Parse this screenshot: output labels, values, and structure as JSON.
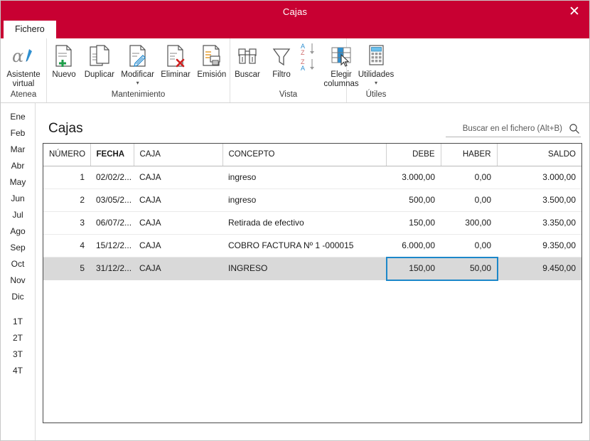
{
  "window": {
    "title": "Cajas",
    "close_label": "✕",
    "tab_label": "Fichero"
  },
  "ribbon": {
    "groups": [
      {
        "label": "Atenea",
        "buttons": [
          {
            "label": "Asistente\nvirtual",
            "icon": "alpha-assistant-icon",
            "caret": false
          }
        ]
      },
      {
        "label": "Mantenimiento",
        "buttons": [
          {
            "label": "Nuevo",
            "icon": "new-document-icon",
            "caret": false
          },
          {
            "label": "Duplicar",
            "icon": "duplicate-document-icon",
            "caret": false
          },
          {
            "label": "Modificar",
            "icon": "edit-document-icon",
            "caret": true
          },
          {
            "label": "Eliminar",
            "icon": "delete-document-icon",
            "caret": false
          },
          {
            "label": "Emisión",
            "icon": "print-report-icon",
            "caret": false
          }
        ]
      },
      {
        "label": "Vista",
        "buttons": [
          {
            "label": "Buscar",
            "icon": "binoculars-icon",
            "caret": false
          },
          {
            "label": "Filtro",
            "icon": "funnel-filter-icon",
            "caret": false
          },
          {
            "label": "",
            "icon": "sort-az-za-icon",
            "caret": false
          },
          {
            "label": "Elegir\ncolumnas",
            "icon": "choose-columns-icon",
            "caret": false
          }
        ]
      },
      {
        "label": "Útiles",
        "buttons": [
          {
            "label": "Utilidades",
            "icon": "calculator-icon",
            "caret": true
          }
        ]
      }
    ]
  },
  "sidebar": {
    "months": [
      "Ene",
      "Feb",
      "Mar",
      "Abr",
      "May",
      "Jun",
      "Jul",
      "Ago",
      "Sep",
      "Oct",
      "Nov",
      "Dic"
    ],
    "quarters": [
      "1T",
      "2T",
      "3T",
      "4T"
    ]
  },
  "main": {
    "page_title": "Cajas",
    "search": {
      "placeholder": "Buscar en el fichero (Alt+B)",
      "value": "",
      "icon": "search-icon"
    },
    "grid": {
      "columns": [
        {
          "key": "numero",
          "label": "NÚMERO",
          "align": "right",
          "sorted": false
        },
        {
          "key": "fecha",
          "label": "FECHA",
          "align": "left",
          "sorted": true
        },
        {
          "key": "caja",
          "label": "CAJA",
          "align": "left",
          "sorted": false
        },
        {
          "key": "concepto",
          "label": "CONCEPTO",
          "align": "left",
          "sorted": false
        },
        {
          "key": "debe",
          "label": "DEBE",
          "align": "right",
          "sorted": false
        },
        {
          "key": "haber",
          "label": "HABER",
          "align": "right",
          "sorted": false
        },
        {
          "key": "saldo",
          "label": "SALDO",
          "align": "right",
          "sorted": false
        }
      ],
      "rows": [
        {
          "numero": "1",
          "fecha": "02/02/2...",
          "caja": "CAJA",
          "concepto": "ingreso",
          "debe": "3.000,00",
          "haber": "0,00",
          "saldo": "3.000,00",
          "selected": false
        },
        {
          "numero": "2",
          "fecha": "03/05/2...",
          "caja": "CAJA",
          "concepto": "ingreso",
          "debe": "500,00",
          "haber": "0,00",
          "saldo": "3.500,00",
          "selected": false
        },
        {
          "numero": "3",
          "fecha": "06/07/2...",
          "caja": "CAJA",
          "concepto": "Retirada de efectivo",
          "debe": "150,00",
          "haber": "300,00",
          "saldo": "3.350,00",
          "selected": false
        },
        {
          "numero": "4",
          "fecha": "15/12/2...",
          "caja": "CAJA",
          "concepto": "COBRO FACTURA Nº 1 -000015",
          "debe": "6.000,00",
          "haber": "0,00",
          "saldo": "9.350,00",
          "selected": false
        },
        {
          "numero": "5",
          "fecha": "31/12/2...",
          "caja": "CAJA",
          "concepto": "INGRESO",
          "debe": "150,00",
          "haber": "50,00",
          "saldo": "9.450,00",
          "selected": true
        }
      ]
    }
  },
  "colors": {
    "titlebar": "#c80032",
    "selection_border": "#1c87c9",
    "row_selected": "#d9d9d9"
  }
}
